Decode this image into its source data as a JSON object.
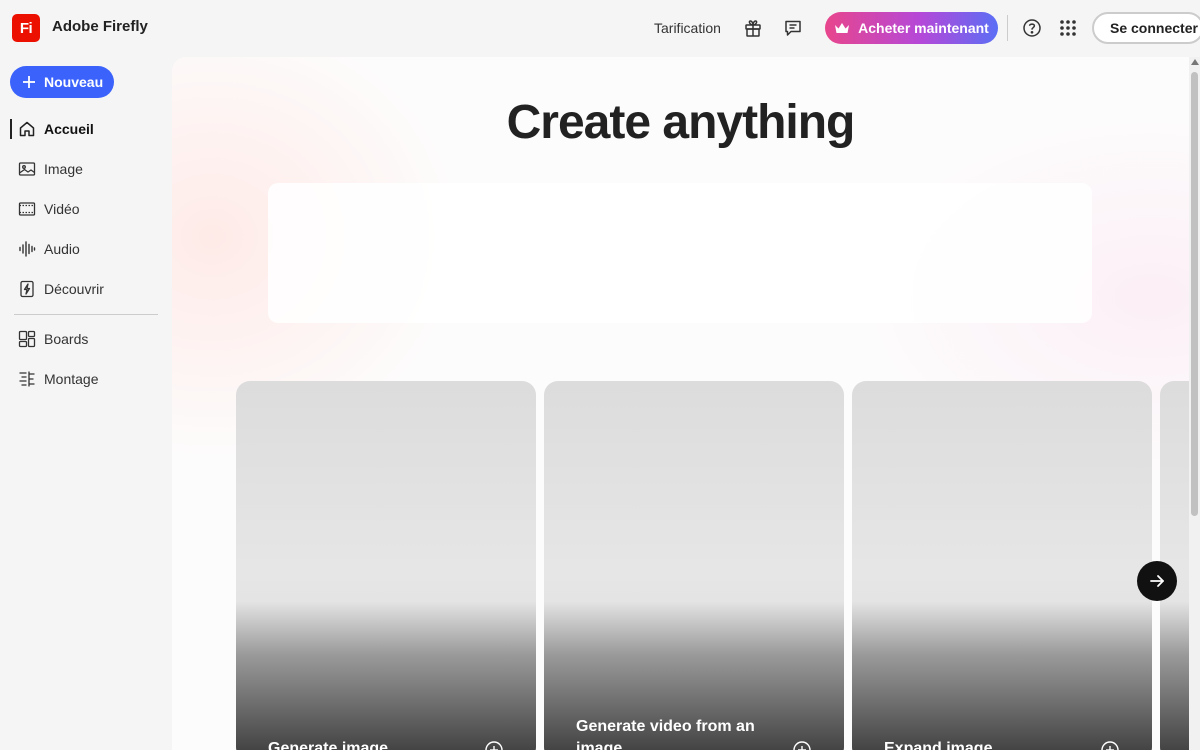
{
  "app": {
    "logo_text": "Fi",
    "title": "Adobe Firefly"
  },
  "header": {
    "pricing_label": "Tarification",
    "buy_label": "Acheter maintenant",
    "signin_label": "Se connecter"
  },
  "sidebar": {
    "new_label": "Nouveau",
    "items": [
      {
        "label": "Accueil",
        "icon": "home-icon",
        "active": true
      },
      {
        "label": "Image",
        "icon": "image-icon"
      },
      {
        "label": "Vidéo",
        "icon": "film-icon"
      },
      {
        "label": "Audio",
        "icon": "waveform-icon"
      },
      {
        "label": "Découvrir",
        "icon": "lightning-icon"
      },
      {
        "label": "Boards",
        "icon": "boards-icon"
      },
      {
        "label": "Montage",
        "icon": "montage-icon"
      }
    ]
  },
  "main": {
    "title": "Create anything",
    "cards": [
      {
        "label": "Generate image"
      },
      {
        "label": "Generate video from an image."
      },
      {
        "label": "Expand image"
      }
    ]
  },
  "colors": {
    "accent": "#3b63fb",
    "brand": "#eb1000",
    "buy_gradient_start": "#e8468c",
    "buy_gradient_end": "#5b6ef5"
  }
}
